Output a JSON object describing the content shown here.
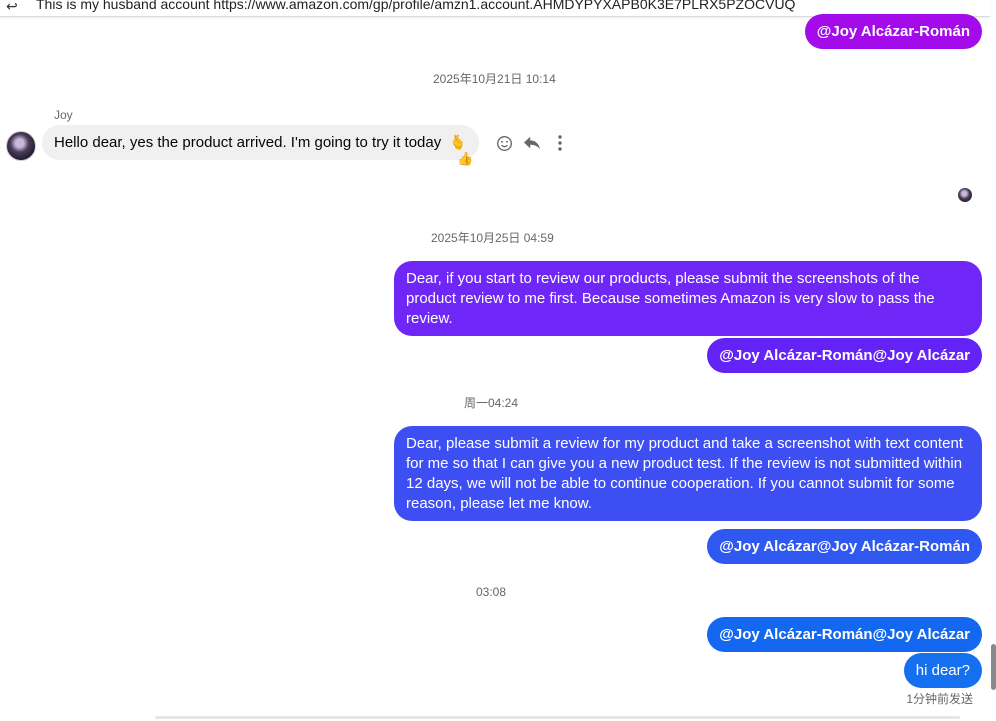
{
  "reply_bar": {
    "text": "This is my husband account https://www.amazon.com/gp/profile/amzn1.account.AHMDYPYXAPB0K3E7PLRX5PZOCVUQ"
  },
  "messages": {
    "mention_1": "@Joy Alcázar-Román",
    "timestamp_1": "2025年10月21日 10:14",
    "incoming_sender": "Joy",
    "incoming_text": "Hello dear, yes the product arrived.  I'm going to try it today",
    "incoming_emoji": "🫰",
    "incoming_reaction": "👍",
    "timestamp_2": "2025年10月25日 04:59",
    "out_1": "Dear, if you start to review our products, please submit the screenshots of the product review to me first. Because sometimes Amazon is very slow to pass the review.",
    "mention_2": "@Joy Alcázar-Román@Joy Alcázar",
    "timestamp_3": "周一04:24",
    "out_2": "Dear, please submit a review for my product and take a screenshot with text content for me so that I can give you a new product test. If the review is not submitted within 12 days, we will not be able to continue cooperation. If you cannot submit for some reason, please let me know.",
    "mention_3": "@Joy Alcázar@Joy Alcázar-Román",
    "timestamp_4": "03:08",
    "mention_4": "@Joy Alcázar-Román@Joy Alcázar",
    "out_3": "hi dear?",
    "sent_status": "1分钟前发送"
  },
  "icons": {
    "react": "smiley-icon",
    "reply": "reply-arrow-icon",
    "more": "more-vertical-icon"
  },
  "colors": {
    "purple": "#a30bea",
    "violet": "#6f27f8",
    "indigo": "#3d4ff2",
    "blue": "#1468f0",
    "incoming_bg": "#f0f0f0"
  }
}
